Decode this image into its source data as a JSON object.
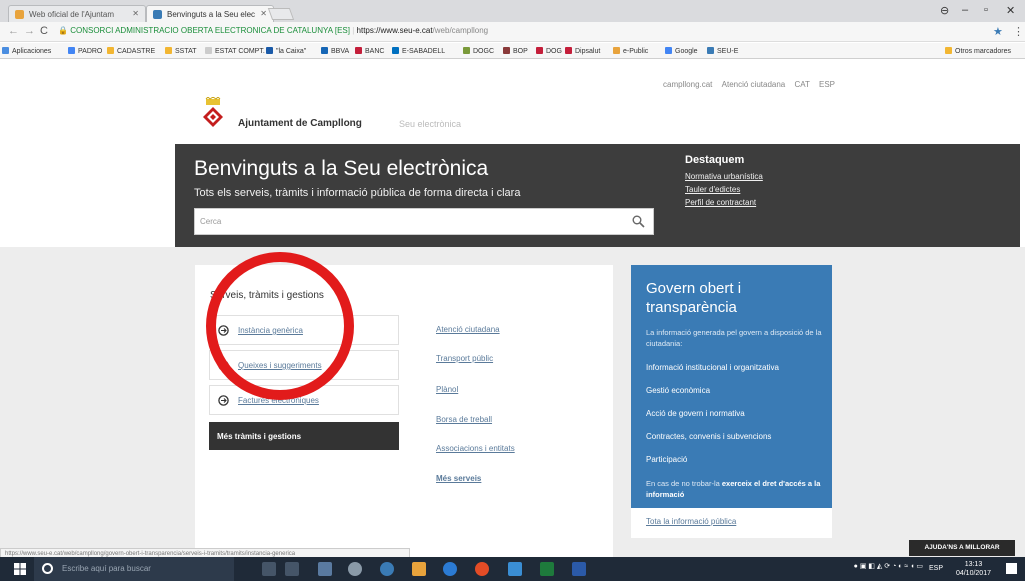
{
  "browser": {
    "tabs": [
      {
        "label": "Web oficial de l'Ajuntam",
        "active": false
      },
      {
        "label": "Benvinguts a la Seu elec",
        "active": true
      }
    ],
    "url": {
      "org": "CONSORCI ADMINISTRACIO OBERTA ELECTRONICA DE CATALUNYA [ES]",
      "host": "https://www.seu-e.cat",
      "path": "/web/campllong"
    },
    "bookmarks": [
      "Aplicaciones",
      "PADRO",
      "CADASTRE",
      "SSTAT",
      "ESTAT COMPT.",
      "\"la Caixa\"",
      "BBVA",
      "BANC",
      "E-SABADELL",
      "DOGC",
      "BOP",
      "DOG",
      "Dipsalut",
      "e-Public",
      "Google",
      "SEU-E",
      "Otros marcadores"
    ]
  },
  "page": {
    "top_links": [
      "campllong.cat",
      "Atenció ciutadana",
      "CAT",
      "ESP"
    ],
    "site_name": "Ajuntament de Campllong",
    "site_sub": "Seu electrònica",
    "hero": {
      "title": "Benvinguts a la Seu electrònica",
      "subtitle": "Tots els serveis, tràmits i informació pública de forma directa i clara",
      "search_placeholder": "Cerca"
    },
    "destaquem": {
      "title": "Destaquem",
      "links": [
        "Normativa urbanística",
        "Tauler d'edictes",
        "Perfil de contractant"
      ]
    },
    "procedures": {
      "title": "Serveis, tràmits i gestions",
      "items": [
        "Instància genèrica",
        "Queixes i suggeriments",
        "Factures electròniques"
      ],
      "more": "Més tràmits i gestions"
    },
    "services": {
      "items": [
        "Atenció ciutadana",
        "Transport públic",
        "Plànol",
        "Borsa de treball",
        "Associacions i entitats"
      ],
      "more": "Més serveis"
    },
    "govern": {
      "title": "Govern obert i transparència",
      "intro": "La informació generada pel govern a disposició de la ciutadania:",
      "items": [
        "Informació institucional i organitzativa",
        "Gestió econòmica",
        "Acció de govern i normativa",
        "Contractes, convenis i subvencions",
        "Participació"
      ],
      "note_pre": "En cas de no trobar-la ",
      "note_bold": "exerceix el dret d'accés a la informació",
      "all": "Tota la informació pública"
    },
    "status_url": "https://www.seu-e.cat/web/campllong/govern-obert-i-transparencia/serveis-i-tramits/tramits/instancia-generica",
    "help_button": "AJUDA'NS A MILLORAR"
  },
  "taskbar": {
    "search_placeholder": "Escribe aquí para buscar",
    "lang": "ESP",
    "time": "13:13",
    "date": "04/10/2017"
  },
  "colors": {
    "hero": "#3d3d3d",
    "govern": "#3a7bb5",
    "annotation_circle": "#e21b1b",
    "link": "#5a7a9a"
  }
}
